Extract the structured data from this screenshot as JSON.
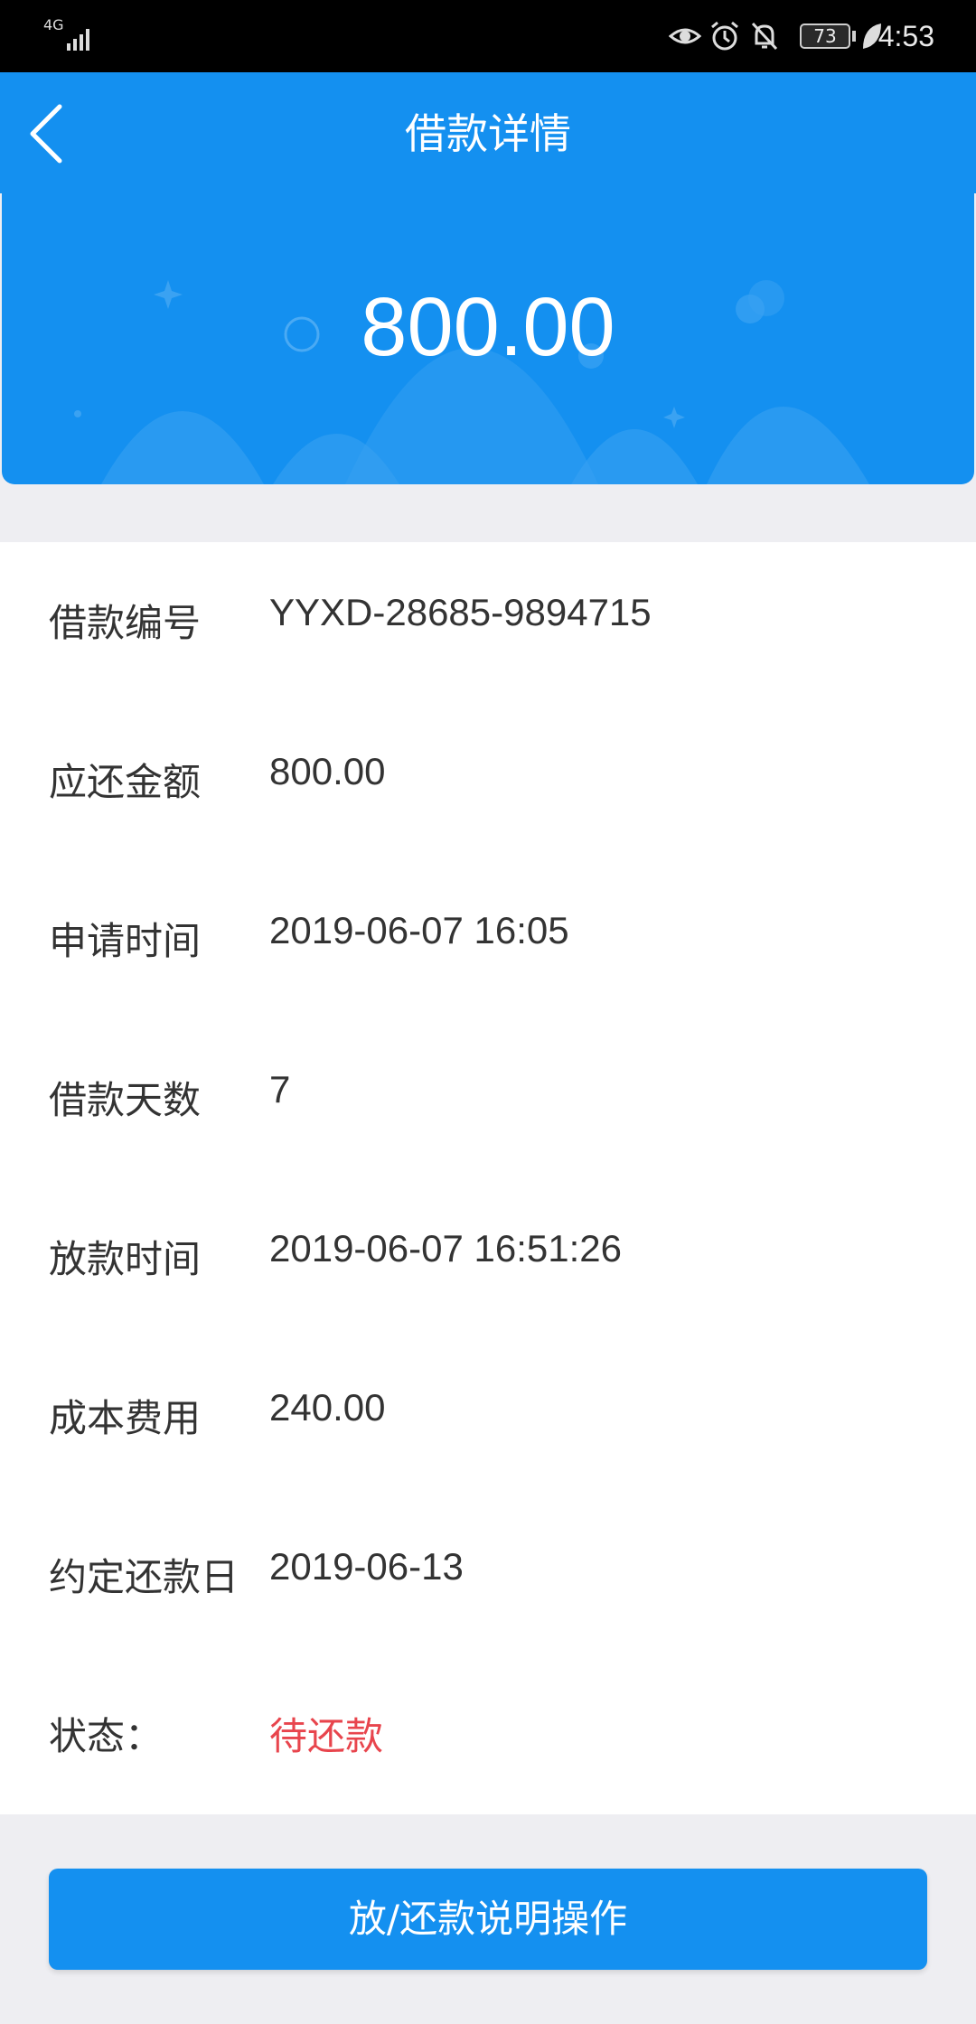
{
  "status_bar": {
    "network": "4G",
    "battery": "73",
    "time": "4:53",
    "icons": [
      "signal-icon",
      "eye-icon",
      "alarm-icon",
      "bell-muted-icon",
      "battery-icon",
      "leaf-icon"
    ]
  },
  "nav": {
    "title": "借款详情",
    "back_icon": "chevron-left-icon"
  },
  "hero": {
    "amount": "800.00"
  },
  "details": [
    {
      "label": "借款编号",
      "value": "YYXD-28685-9894715"
    },
    {
      "label": "应还金额",
      "value": "800.00"
    },
    {
      "label": "申请时间",
      "value": "2019-06-07 16:05"
    },
    {
      "label": "借款天数",
      "value": "7"
    },
    {
      "label": "放款时间",
      "value": "2019-06-07 16:51:26"
    },
    {
      "label": "成本费用",
      "value": "240.00"
    },
    {
      "label": "约定还款日",
      "value": "2019-06-13"
    },
    {
      "label": "状态：",
      "value": "待还款"
    }
  ],
  "action_button": {
    "label": "放/还款说明操作"
  },
  "colors": {
    "primary": "#1490f0",
    "status_pending": "#e8454d",
    "background": "#eeeef2"
  }
}
